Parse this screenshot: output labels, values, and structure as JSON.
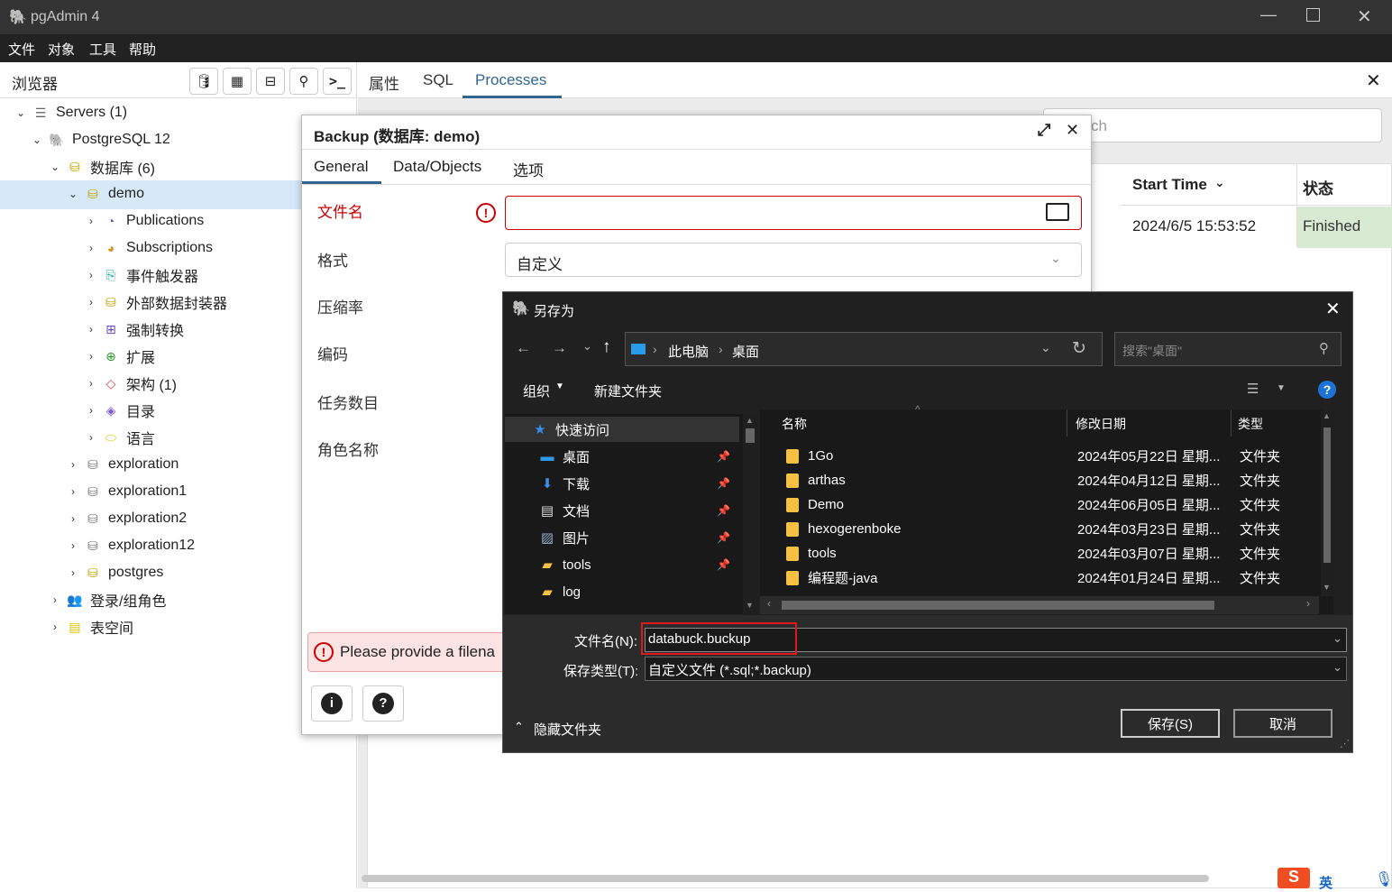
{
  "app": {
    "title": "pgAdmin 4"
  },
  "menu": [
    "文件",
    "对象",
    "工具",
    "帮助"
  ],
  "browser": {
    "title": "浏览器",
    "tree": [
      {
        "label": "Servers (1)",
        "chev": "⌄"
      },
      {
        "label": "PostgreSQL 12",
        "chev": "⌄"
      },
      {
        "label": "数据库 (6)",
        "chev": "⌄"
      },
      {
        "label": "demo",
        "chev": "⌄"
      },
      {
        "label": "Publications",
        "chev": "›"
      },
      {
        "label": "Subscriptions",
        "chev": "›"
      },
      {
        "label": "事件触发器",
        "chev": "›"
      },
      {
        "label": "外部数据封装器",
        "chev": "›"
      },
      {
        "label": "强制转换",
        "chev": "›"
      },
      {
        "label": "扩展",
        "chev": "›"
      },
      {
        "label": "架构 (1)",
        "chev": "›"
      },
      {
        "label": "目录",
        "chev": "›"
      },
      {
        "label": "语言",
        "chev": "›"
      },
      {
        "label": "exploration",
        "chev": "›"
      },
      {
        "label": "exploration1",
        "chev": "›"
      },
      {
        "label": "exploration2",
        "chev": "›"
      },
      {
        "label": "exploration12",
        "chev": "›"
      },
      {
        "label": "postgres",
        "chev": "›"
      },
      {
        "label": "登录/组角色",
        "chev": "›"
      },
      {
        "label": "表空间",
        "chev": "›"
      }
    ]
  },
  "main": {
    "tabs": [
      "属性",
      "SQL",
      "Processes"
    ],
    "search_fragment": "ch",
    "table": {
      "col_start": "Start Time",
      "col_status": "状态",
      "start": "2024/6/5 15:53:52",
      "status": "Finished"
    }
  },
  "backup": {
    "title": "Backup (数据库: demo)",
    "tabs": [
      "General",
      "Data/Objects",
      "选项"
    ],
    "labels": [
      "文件名",
      "格式",
      "压缩率",
      "编码",
      "任务数目",
      "角色名称"
    ],
    "format_value": "自定义",
    "error": "Please provide a filena"
  },
  "saveas": {
    "title": "另存为",
    "path": [
      "此电脑",
      "桌面"
    ],
    "search_placeholder": "搜索\"桌面\"",
    "organize": "组织",
    "new_folder": "新建文件夹",
    "nav": [
      {
        "label": "快速访问"
      },
      {
        "label": "桌面"
      },
      {
        "label": "下载"
      },
      {
        "label": "文档"
      },
      {
        "label": "图片"
      },
      {
        "label": "tools"
      },
      {
        "label": "log"
      }
    ],
    "cols": [
      "名称",
      "修改日期",
      "类型"
    ],
    "files": [
      {
        "name": "1Go",
        "date": "2024年05月22日 星期...",
        "type": "文件夹"
      },
      {
        "name": "arthas",
        "date": "2024年04月12日 星期...",
        "type": "文件夹"
      },
      {
        "name": "Demo",
        "date": "2024年06月05日 星期...",
        "type": "文件夹"
      },
      {
        "name": "hexogerenboke",
        "date": "2024年03月23日 星期...",
        "type": "文件夹"
      },
      {
        "name": "tools",
        "date": "2024年03月07日 星期...",
        "type": "文件夹"
      },
      {
        "name": "编程题-java",
        "date": "2024年01月24日 星期...",
        "type": "文件夹"
      }
    ],
    "filename_label": "文件名(N):",
    "filename_value": "databuck.buckup",
    "filetype_label": "保存类型(T):",
    "filetype_value": "自定义文件 (*.sql;*.backup)",
    "hide_folders": "隐藏文件夹",
    "save": "保存(S)",
    "cancel": "取消"
  },
  "taskbar": {
    "ime": "英"
  }
}
